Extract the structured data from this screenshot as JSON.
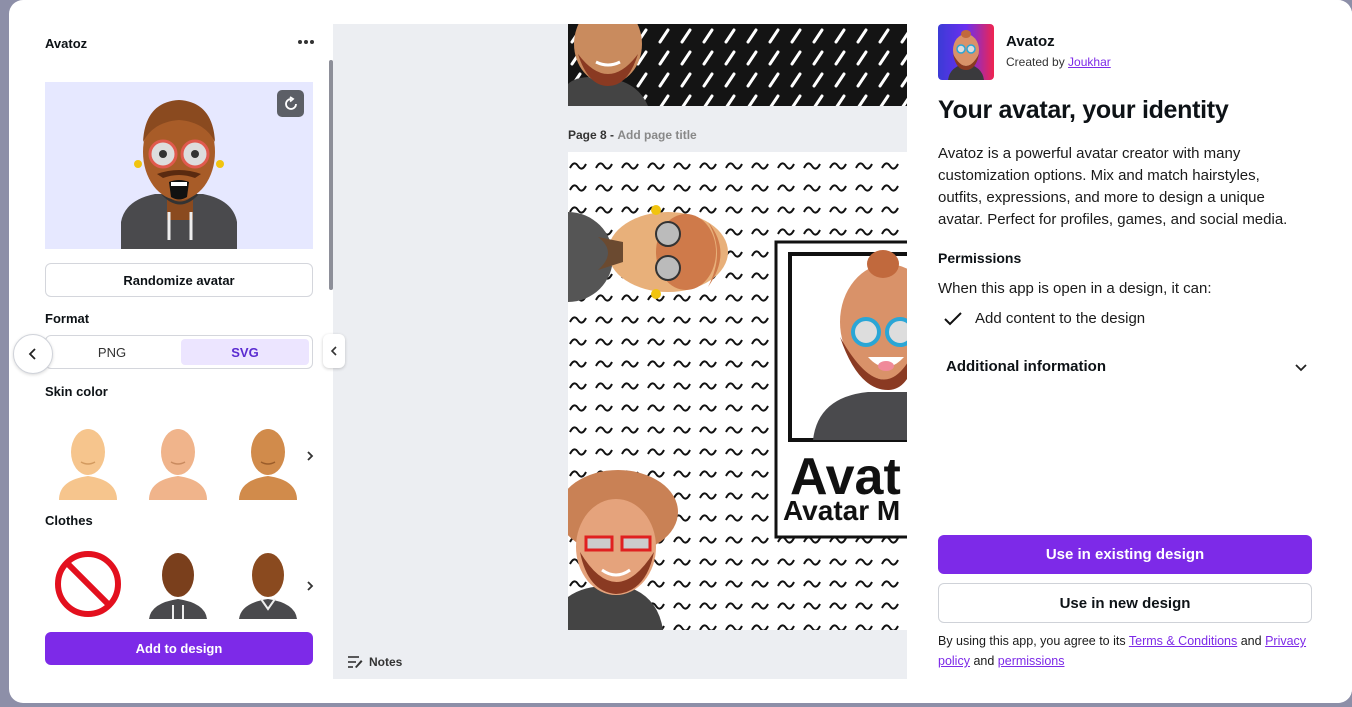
{
  "app": {
    "panel_title": "Avatoz",
    "randomize_label": "Randomize avatar",
    "format_label": "Format",
    "format_options": [
      "PNG",
      "SVG"
    ],
    "format_selected": "SVG",
    "skin_color_label": "Skin color",
    "clothes_label": "Clothes",
    "add_to_design_label": "Add to design"
  },
  "canvas": {
    "page_label": "Page 8 -",
    "page_title_placeholder": "Add page title",
    "page_text_large": "Avat",
    "page_text_small": "Avatar M",
    "notes_label": "Notes"
  },
  "details": {
    "app_name": "Avatoz",
    "created_by_prefix": "Created by",
    "creator": "Joukhar",
    "headline": "Your avatar, your identity",
    "description": "Avatoz is a powerful avatar creator with many customization options. Mix and match hairstyles, outfits, expressions, and more to design a unique avatar. Perfect for profiles, games, and social media.",
    "permissions_title": "Permissions",
    "permissions_intro": "When this app is open in a design, it can:",
    "permission_item": "Add content to the design",
    "additional_info": "Additional information",
    "use_existing": "Use in existing design",
    "use_new": "Use in new design",
    "terms_prefix": "By using this app, you agree to its",
    "terms_link": "Terms & Conditions",
    "terms_and": "and",
    "privacy_link": "Privacy policy",
    "terms_and2": "and",
    "permissions_link": "permissions"
  },
  "icons": {
    "more": "more-icon",
    "refresh": "refresh-icon",
    "back": "chevron-left-icon",
    "collapse": "chevron-left-icon",
    "next": "chevron-right-icon",
    "check": "check-icon",
    "expand": "chevron-down-icon",
    "notes": "notes-icon",
    "none": "prohibited-icon"
  },
  "colors": {
    "accent": "#7d2ae8",
    "preview_bg": "#e6e8ff",
    "segment_selected": "#ece5ff"
  }
}
